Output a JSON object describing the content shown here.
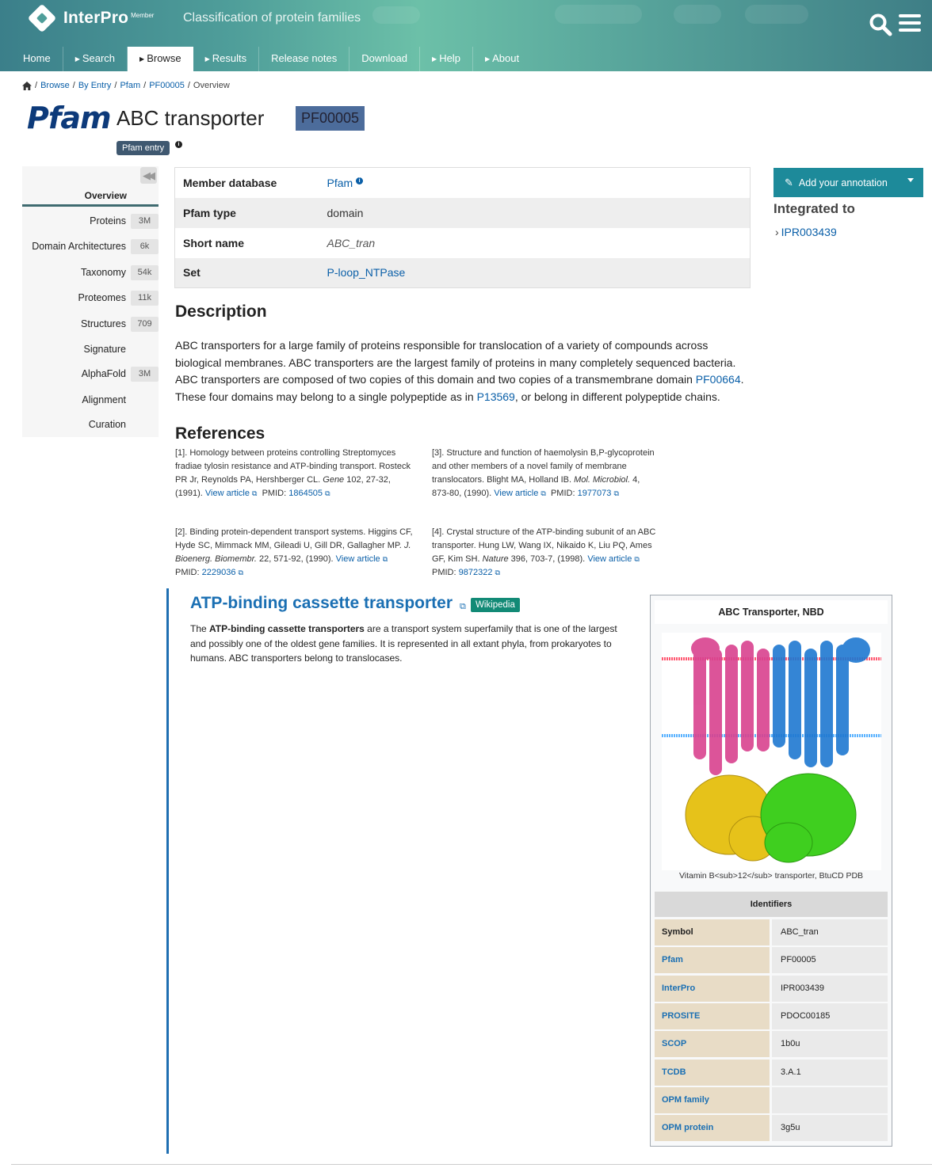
{
  "header": {
    "app_name": "InterPro",
    "member_label": "Member",
    "tagline": "Classification of protein families"
  },
  "nav": [
    {
      "label": "Home",
      "arrow": false,
      "active": false
    },
    {
      "label": "Search",
      "arrow": true,
      "active": false
    },
    {
      "label": "Browse",
      "arrow": true,
      "active": true
    },
    {
      "label": "Results",
      "arrow": true,
      "active": false
    },
    {
      "label": "Release notes",
      "arrow": false,
      "active": false
    },
    {
      "label": "Download",
      "arrow": false,
      "active": false
    },
    {
      "label": "Help",
      "arrow": true,
      "active": false
    },
    {
      "label": "About",
      "arrow": true,
      "active": false
    }
  ],
  "breadcrumb": {
    "items": [
      "Browse",
      "By Entry",
      "Pfam",
      "PF00005"
    ],
    "current": "Overview"
  },
  "entry": {
    "db_logo": "Pfam",
    "title": "ABC transporter",
    "accession": "PF00005",
    "tag": "Pfam entry"
  },
  "sidebar": {
    "overview": "Overview",
    "items": [
      {
        "label": "Proteins",
        "count": "3M"
      },
      {
        "label": "Domain Architectures",
        "count": "6k"
      },
      {
        "label": "Taxonomy",
        "count": "54k"
      },
      {
        "label": "Proteomes",
        "count": "11k"
      },
      {
        "label": "Structures",
        "count": "709"
      },
      {
        "label": "Signature",
        "count": ""
      },
      {
        "label": "AlphaFold",
        "count": "3M"
      },
      {
        "label": "Alignment",
        "count": ""
      },
      {
        "label": "Curation",
        "count": ""
      }
    ]
  },
  "info": {
    "member_db_label": "Member database",
    "member_db_value": "Pfam",
    "type_label": "Pfam type",
    "type_value": "domain",
    "short_name_label": "Short name",
    "short_name_value": "ABC_tran",
    "set_label": "Set",
    "set_value": "P-loop_NTPase"
  },
  "annotation": {
    "button": "Add your annotation",
    "integrated_heading": "Integrated to",
    "integrated_link": "IPR003439"
  },
  "description": {
    "heading": "Description",
    "part1": "ABC transporters for a large family of proteins responsible for translocation of a variety of compounds across biological membranes. ABC transporters are the largest family of proteins in many completely sequenced bacteria. ABC transporters are composed of two copies of this domain and two copies of a transmembrane domain ",
    "link1": "PF00664",
    "part2": ". These four domains may belong to a single polypeptide as in ",
    "link2": "P13569",
    "part3": ", or belong in different polypeptide chains."
  },
  "references": {
    "heading": "References",
    "view_article": "View article",
    "pmid_label": "PMID:",
    "items": [
      {
        "num": "[1].",
        "text": "Homology between proteins controlling Streptomyces fradiae tylosin resistance and ATP-binding transport. Rosteck PR Jr, Reynolds PA, Hershberger CL.",
        "journal": "Gene",
        "citation": "102, 27-32, (1991).",
        "pmid": "1864505"
      },
      {
        "num": "[2].",
        "text": "Binding protein-dependent transport systems. Higgins CF, Hyde SC, Mimmack MM, Gileadi U, Gill DR, Gallagher MP.",
        "journal": "J. Bioenerg. Biomembr.",
        "citation": "22, 571-92, (1990).",
        "pmid": "2229036"
      },
      {
        "num": "[3].",
        "text": "Structure and function of haemolysin B,P-glycoprotein and other members of a novel family of membrane translocators. Blight MA, Holland IB.",
        "journal": "Mol. Microbiol.",
        "citation": "4, 873-80, (1990).",
        "pmid": "1977073"
      },
      {
        "num": "[4].",
        "text": "Crystal structure of the ATP-binding subunit of an ABC transporter. Hung LW, Wang IX, Nikaido K, Liu PQ, Ames GF, Kim SH.",
        "journal": "Nature",
        "citation": "396, 703-7, (1998).",
        "pmid": "9872322"
      }
    ]
  },
  "wikipedia": {
    "title": "ATP-binding cassette transporter",
    "badge": "Wikipedia",
    "text_pre": "The ",
    "text_bold": "ATP-binding cassette transporters",
    "text_post": " are a transport system superfamily that is one of the largest and possibly one of the oldest gene families. It is represented in all extant phyla, from prokaryotes to humans. ABC transporters belong to translocases."
  },
  "infobox": {
    "title": "ABC Transporter, NBD",
    "caption": "Vitamin B<sub>12</sub> transporter, BtuCD PDB",
    "identifiers_heading": "Identifiers",
    "rows": [
      {
        "key": "Symbol",
        "value": "ABC_tran",
        "link": false
      },
      {
        "key": "Pfam",
        "value": "PF00005",
        "link": true
      },
      {
        "key": "InterPro",
        "value": "IPR003439",
        "link": true
      },
      {
        "key": "PROSITE",
        "value": "PDOC00185",
        "link": true
      },
      {
        "key": "SCOP",
        "value": "1b0u",
        "link": true
      },
      {
        "key": "TCDB",
        "value": "3.A.1",
        "link": true
      },
      {
        "key": "OPM family",
        "value": "",
        "link": true
      },
      {
        "key": "OPM protein",
        "value": "3g5u",
        "link": true
      }
    ]
  },
  "colors": {
    "header_teal": "#4f9e9a",
    "link_blue": "#0a5fa8",
    "accession_badge": "#4c6c9b",
    "annot_button": "#1d8a9a",
    "wiki_badge": "#128a76"
  },
  "icons": [
    "home-icon",
    "search-icon",
    "menu-icon",
    "info-icon",
    "pencil-icon",
    "chevron-right-icon",
    "external-link-icon",
    "collapse-icon"
  ]
}
